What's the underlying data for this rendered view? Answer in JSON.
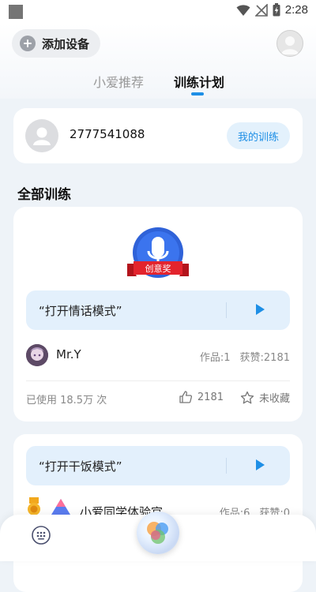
{
  "status_bar": {
    "time": "2:28"
  },
  "header": {
    "add_device_label": "添加设备",
    "tabs": [
      {
        "label": "小爱推荐",
        "active": false
      },
      {
        "label": "训练计划",
        "active": true
      }
    ]
  },
  "user_card": {
    "user_id": "2777541088",
    "my_training_label": "我的训练"
  },
  "section": {
    "title": "全部训练"
  },
  "trainings": [
    {
      "badge_label": "创意奖",
      "phrase": "“打开情话模式”",
      "author": "Mr.Y",
      "works": "作品:1",
      "likes_meta": "获赞:2181",
      "used": "已使用 18.5万 次",
      "likes": "2181",
      "favorite": "未收藏"
    },
    {
      "phrase": "“打开干饭模式”",
      "author": "小爱同学体验官",
      "works": "作品:6",
      "likes_meta": "获赞:0"
    }
  ],
  "colors": {
    "accent": "#1e8fe6",
    "background": "#eef3f8",
    "phrase_box": "#e3f0fc"
  }
}
